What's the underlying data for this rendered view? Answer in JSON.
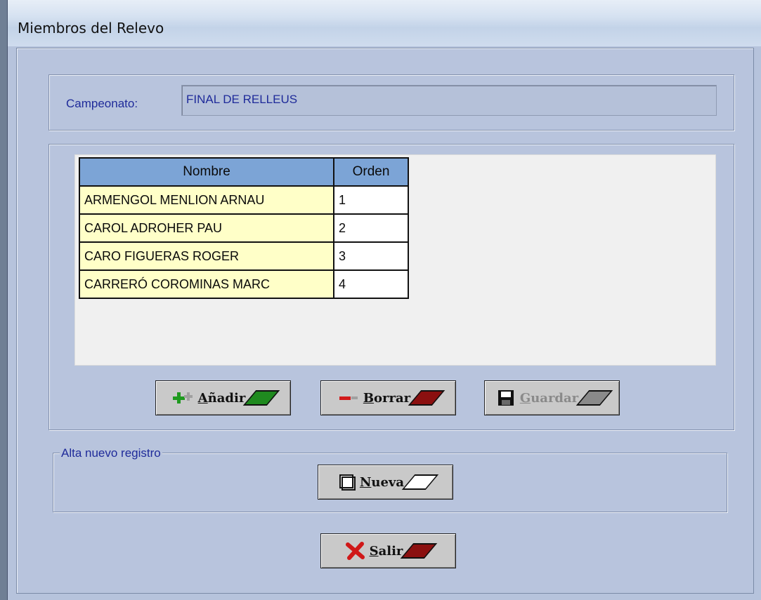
{
  "window": {
    "title": "Miembros del Relevo"
  },
  "campeonato": {
    "label": "Campeonato:",
    "value": "FINAL DE RELLEUS"
  },
  "grid": {
    "headers": [
      "Nombre",
      "Orden"
    ],
    "rows": [
      {
        "nombre": "ARMENGOL MENLION ARNAU",
        "orden": "1"
      },
      {
        "nombre": "CAROL ADROHER PAU",
        "orden": "2"
      },
      {
        "nombre": "CARO FIGUERAS ROGER",
        "orden": "3"
      },
      {
        "nombre": "CARRERÓ COROMINAS MARC",
        "orden": "4"
      }
    ]
  },
  "buttons": {
    "anadir": {
      "mnemonic": "A",
      "rest": "ñadir",
      "color": "#1f8a1f"
    },
    "borrar": {
      "mnemonic": "B",
      "rest": "orrar",
      "color": "#8b1010"
    },
    "guardar": {
      "mnemonic": "G",
      "rest": "uardar",
      "color": "#8a8a8a"
    },
    "nueva": {
      "mnemonic": "N",
      "rest": "ueva",
      "color": "#ffffff"
    },
    "salir": {
      "mnemonic": "S",
      "rest": "alir",
      "color": "#8b1010"
    }
  },
  "alta": {
    "legend": "Alta nuevo registro"
  },
  "icons": {
    "anadir": "plus-icon",
    "borrar": "minus-icon",
    "guardar": "save-icon",
    "nueva": "new-document-icon",
    "salir": "close-x-icon"
  }
}
